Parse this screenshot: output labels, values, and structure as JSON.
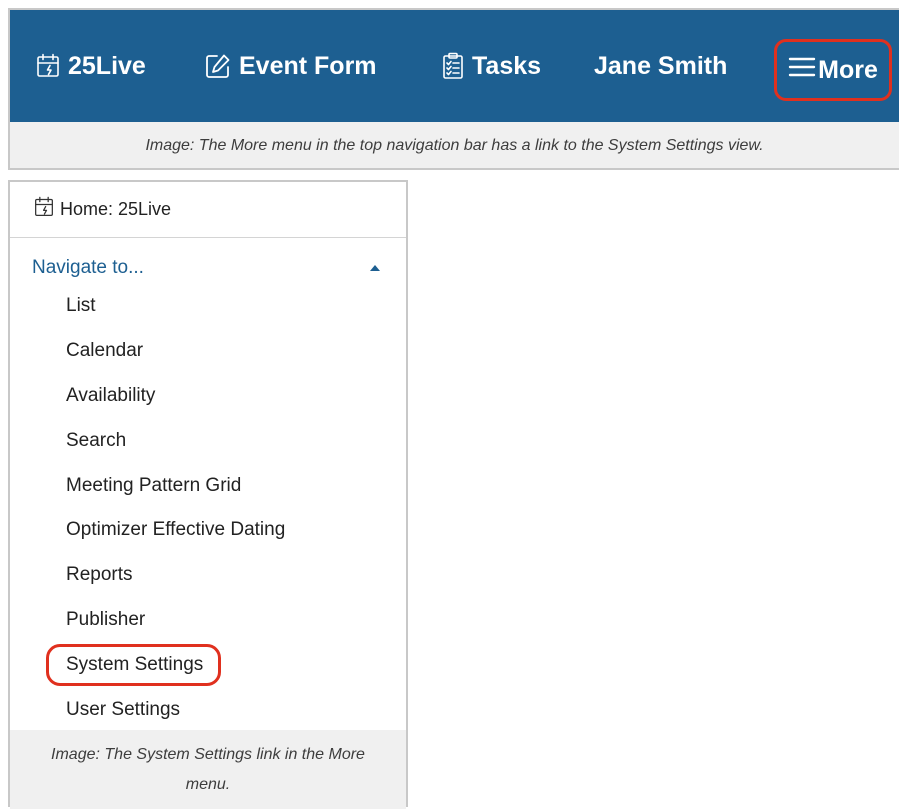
{
  "navbar": {
    "background": "#1d5f91",
    "highlight_color": "#e0301e",
    "items": [
      {
        "label": "25Live",
        "icon": "calendar-icon"
      },
      {
        "label": "Event Form",
        "icon": "edit-icon"
      },
      {
        "label": "Tasks",
        "icon": "clipboard-icon"
      },
      {
        "label": "Jane Smith"
      }
    ],
    "more": {
      "label": "More",
      "icon": "hamburger-icon"
    },
    "caption": "Image: The More menu in the top navigation bar has a link to the System Settings view."
  },
  "menu": {
    "home_label": "Home: 25Live",
    "home_icon": "calendar-icon",
    "navigate_label": "Navigate to...",
    "navigate_icon": "caret-up-icon",
    "items": [
      "List",
      "Calendar",
      "Availability",
      "Search",
      "Meeting Pattern Grid",
      "Optimizer Effective Dating",
      "Reports",
      "Publisher",
      "System Settings",
      "User Settings"
    ],
    "highlighted_item": "System Settings",
    "caption": "Image: The System Settings link in the More menu."
  }
}
